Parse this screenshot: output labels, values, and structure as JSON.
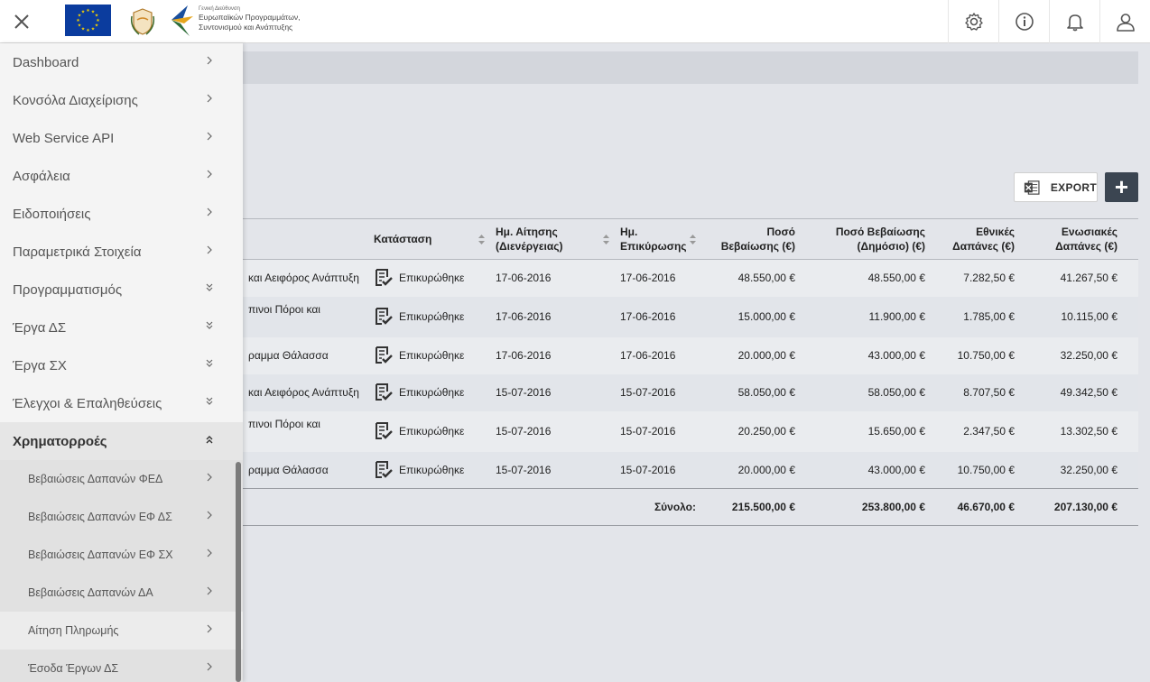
{
  "header": {
    "close_icon": "close-icon",
    "logos": {
      "dg_line1": "Γενική Διεύθυνση",
      "dg_line2": "Ευρωπαϊκών Προγραμμάτων,",
      "dg_line3": "Συντονισμού και Ανάπτυξης"
    },
    "icons": [
      "settings-icon",
      "info-icon",
      "notification-bell-icon",
      "user-icon"
    ]
  },
  "sidebar": {
    "items": [
      {
        "label": "Dashboard",
        "chevron": "right"
      },
      {
        "label": "Κονσόλα Διαχείρισης",
        "chevron": "right"
      },
      {
        "label": "Web Service API",
        "chevron": "right"
      },
      {
        "label": "Ασφάλεια",
        "chevron": "right"
      },
      {
        "label": "Ειδοποιήσεις",
        "chevron": "right"
      },
      {
        "label": "Παραμετρικά Στοιχεία",
        "chevron": "right"
      },
      {
        "label": "Προγραμματισμός",
        "chevron": "double-down"
      },
      {
        "label": "Έργα ΔΣ",
        "chevron": "double-down"
      },
      {
        "label": "Έργα ΣΧ",
        "chevron": "double-down"
      },
      {
        "label": "Έλεγχοι & Επαληθεύσεις",
        "chevron": "double-down"
      },
      {
        "label": "Χρηματορροές",
        "chevron": "double-up"
      }
    ],
    "subitems": [
      {
        "label": "Βεβαιώσεις Δαπανών ΦΕΔ"
      },
      {
        "label": "Βεβαιώσεις Δαπανών ΕΦ ΔΣ"
      },
      {
        "label": "Βεβαιώσεις Δαπανών ΕΦ ΣΧ"
      },
      {
        "label": "Βεβαιώσεις Δαπανών ΔΑ"
      },
      {
        "label": "Αίτηση Πληρωμής"
      },
      {
        "label": "Έσοδα Έργων ΔΣ"
      }
    ]
  },
  "toolbar": {
    "export_label": "EXPORT",
    "add_label": "+"
  },
  "table": {
    "headers": {
      "status": "Κατάσταση",
      "request_date_1": "Ημ. Αίτησης",
      "request_date_2": "(Διενέργειας)",
      "validation_date_1": "Ημ.",
      "validation_date_2": "Επικύρωσης",
      "amount_1": "Ποσό",
      "amount_2": "Βεβαίωσης (€)",
      "public_amount_1": "Ποσό Βεβαίωσης",
      "public_amount_2": "(Δημόσιο) (€)",
      "national_1": "Εθνικές",
      "national_2": "Δαπάνες (€)",
      "eu_1": "Ενωσιακές",
      "eu_2": "Δαπάνες (€)"
    },
    "rows": [
      {
        "program": "και Αειφόρος Ανάπτυξη",
        "program2": "",
        "status": "Επικυρώθηκε",
        "request_date": "17-06-2016",
        "validation_date": "17-06-2016",
        "amount": "48.550,00 €",
        "public_amount": "48.550,00 €",
        "national": "7.282,50 €",
        "eu": "41.267,50 €"
      },
      {
        "program": "πινοι Πόροι και",
        "program2": "",
        "status": "Επικυρώθηκε",
        "request_date": "17-06-2016",
        "validation_date": "17-06-2016",
        "amount": "15.000,00 €",
        "public_amount": "11.900,00 €",
        "national": "1.785,00 €",
        "eu": "10.115,00 €"
      },
      {
        "program": "ραμμα Θάλασσα",
        "program2": "",
        "status": "Επικυρώθηκε",
        "request_date": "17-06-2016",
        "validation_date": "17-06-2016",
        "amount": "20.000,00 €",
        "public_amount": "43.000,00 €",
        "national": "10.750,00 €",
        "eu": "32.250,00 €"
      },
      {
        "program": "και Αειφόρος Ανάπτυξη",
        "program2": "",
        "status": "Επικυρώθηκε",
        "request_date": "15-07-2016",
        "validation_date": "15-07-2016",
        "amount": "58.050,00 €",
        "public_amount": "58.050,00 €",
        "national": "8.707,50 €",
        "eu": "49.342,50 €"
      },
      {
        "program": "πινοι Πόροι και",
        "program2": "",
        "status": "Επικυρώθηκε",
        "request_date": "15-07-2016",
        "validation_date": "15-07-2016",
        "amount": "20.250,00 €",
        "public_amount": "15.650,00 €",
        "national": "2.347,50 €",
        "eu": "13.302,50 €"
      },
      {
        "program": "ραμμα Θάλασσα",
        "program2": "",
        "status": "Επικυρώθηκε",
        "request_date": "15-07-2016",
        "validation_date": "15-07-2016",
        "amount": "20.000,00 €",
        "public_amount": "43.000,00 €",
        "national": "10.750,00 €",
        "eu": "32.250,00 €"
      }
    ],
    "totals": {
      "label": "Σύνολο:",
      "amount": "215.500,00 €",
      "public_amount": "253.800,00 €",
      "national": "46.670,00 €",
      "eu": "207.130,00 €"
    }
  }
}
